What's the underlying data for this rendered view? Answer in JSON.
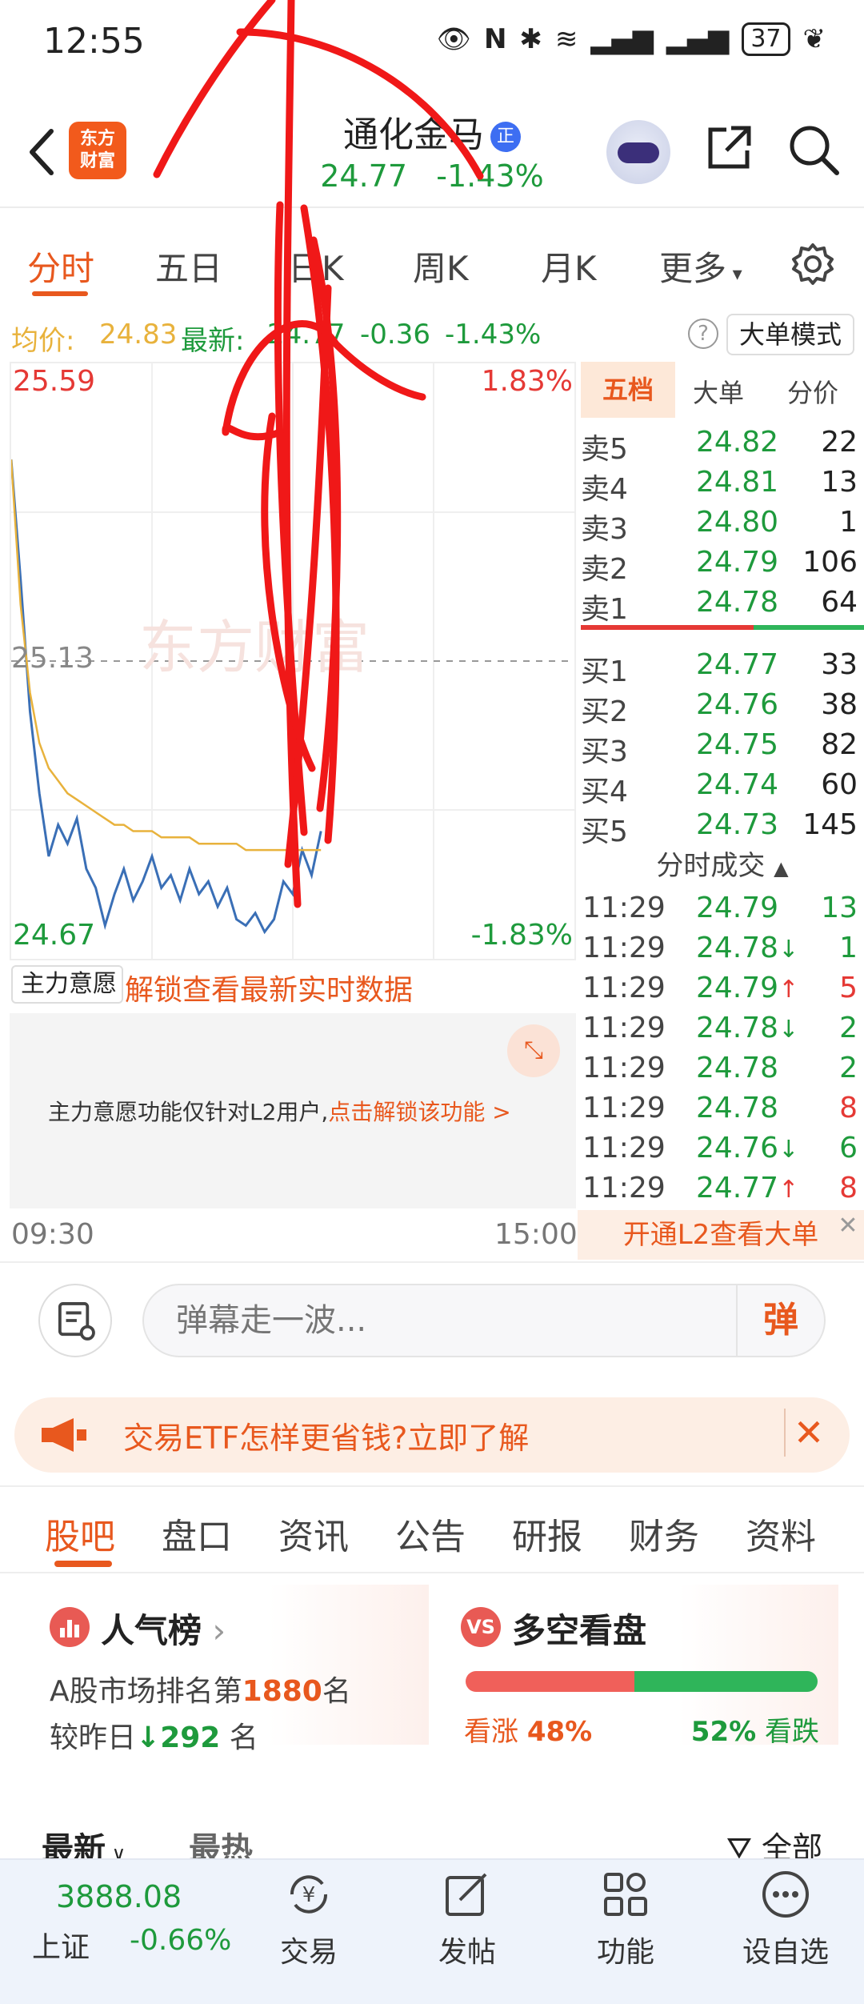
{
  "status_bar": {
    "time": "12:55",
    "battery": "37"
  },
  "header": {
    "app_logo": "东方\n财富",
    "stock_name": "通化金马",
    "badge": "正",
    "price": "24.77",
    "change_pct": "-1.43%"
  },
  "period_tabs": [
    "分时",
    "五日",
    "日K",
    "周K",
    "月K",
    "更多"
  ],
  "info_strip": {
    "avg_label": "均价:",
    "avg_value": "24.83",
    "latest_label": "最新:",
    "latest_value": "24.77",
    "change": "-0.36",
    "change_pct": "-1.43%",
    "mode_button": "大单模式"
  },
  "chart": {
    "high_label": "25.59",
    "high_pct": "1.83%",
    "mid_label": "25.13",
    "low_label": "24.67",
    "low_pct": "-1.83%",
    "time_start": "09:30",
    "time_end": "15:00",
    "watermark": "东方财富"
  },
  "chart_data": {
    "type": "line",
    "ylim": [
      24.67,
      25.59
    ],
    "reference": 25.13,
    "series": [
      {
        "name": "price",
        "color": "#3a6fb6",
        "values": [
          25.45,
          25.26,
          25.05,
          24.92,
          24.82,
          24.87,
          24.84,
          24.88,
          24.8,
          24.77,
          24.71,
          24.76,
          24.8,
          24.75,
          24.78,
          24.82,
          24.77,
          24.79,
          24.75,
          24.8,
          24.76,
          24.78,
          24.74,
          24.77,
          24.72,
          24.71,
          24.73,
          24.7,
          24.72,
          24.78,
          24.76,
          24.83,
          24.79,
          24.86
        ]
      },
      {
        "name": "avg",
        "color": "#e8b23c",
        "values": [
          25.45,
          25.22,
          25.08,
          25.0,
          24.96,
          24.94,
          24.92,
          24.91,
          24.9,
          24.89,
          24.88,
          24.87,
          24.87,
          24.86,
          24.86,
          24.86,
          24.85,
          24.85,
          24.85,
          24.85,
          24.84,
          24.84,
          24.84,
          24.84,
          24.84,
          24.83,
          24.83,
          24.83,
          24.83,
          24.83,
          24.83,
          24.83,
          24.83,
          24.83
        ]
      }
    ]
  },
  "order_book": {
    "tabs": [
      "五档",
      "大单",
      "分价"
    ],
    "sells": [
      {
        "label": "卖5",
        "price": "24.82",
        "vol": "22"
      },
      {
        "label": "卖4",
        "price": "24.81",
        "vol": "13"
      },
      {
        "label": "卖3",
        "price": "24.80",
        "vol": "1"
      },
      {
        "label": "卖2",
        "price": "24.79",
        "vol": "106"
      },
      {
        "label": "卖1",
        "price": "24.78",
        "vol": "64"
      }
    ],
    "buys": [
      {
        "label": "买1",
        "price": "24.77",
        "vol": "33"
      },
      {
        "label": "买2",
        "price": "24.76",
        "vol": "38"
      },
      {
        "label": "买3",
        "price": "24.75",
        "vol": "82"
      },
      {
        "label": "买4",
        "price": "24.74",
        "vol": "60"
      },
      {
        "label": "买5",
        "price": "24.73",
        "vol": "145"
      }
    ],
    "trades_header": "分时成交",
    "trades": [
      {
        "time": "11:29",
        "price": "24.79",
        "arrow": "",
        "vol": "13",
        "color": "#1e9a3c"
      },
      {
        "time": "11:29",
        "price": "24.78",
        "arrow": "↓",
        "vol": "1",
        "color": "#1e9a3c"
      },
      {
        "time": "11:29",
        "price": "24.79",
        "arrow": "↑",
        "vol": "5",
        "color": "#e53935"
      },
      {
        "time": "11:29",
        "price": "24.78",
        "arrow": "↓",
        "vol": "2",
        "color": "#1e9a3c"
      },
      {
        "time": "11:29",
        "price": "24.78",
        "arrow": "",
        "vol": "2",
        "color": "#1e9a3c"
      },
      {
        "time": "11:29",
        "price": "24.78",
        "arrow": "",
        "vol": "8",
        "color": "#e53935"
      },
      {
        "time": "11:29",
        "price": "24.76",
        "arrow": "↓",
        "vol": "6",
        "color": "#1e9a3c"
      },
      {
        "time": "11:29",
        "price": "24.77",
        "arrow": "↑",
        "vol": "8",
        "color": "#e53935"
      }
    ],
    "l2_open": "开通L2查看大单"
  },
  "main_force": {
    "selector": "主力意愿",
    "unlock": "解锁查看最新实时数据",
    "notice": "主力意愿功能仅针对L2用户,",
    "notice_link": "点击解锁该功能 >"
  },
  "danmu": {
    "placeholder": "弹幕走一波...",
    "button": "弹"
  },
  "ad": {
    "text": "交易ETF怎样更省钱?立即了解"
  },
  "content_tabs": [
    "股吧",
    "盘口",
    "资讯",
    "公告",
    "研报",
    "财务",
    "资料"
  ],
  "popularity": {
    "title": "人气榜",
    "line1_prefix": "A股市场排名第",
    "rank": "1880",
    "line1_suffix": "名",
    "line2_prefix": "较昨日",
    "delta": "292",
    "line2_suffix": "名"
  },
  "sentiment": {
    "title": "多空看盘",
    "up_label": "看涨",
    "up_pct": "48%",
    "down_pct": "52%",
    "down_label": "看跌",
    "up_value": 48
  },
  "sort": {
    "latest": "最新",
    "hot": "最热",
    "filter": "全部"
  },
  "bottom_nav": {
    "index_value": "3888.08",
    "index_name": "上证",
    "index_change": "-0.66%",
    "items": [
      "交易",
      "发帖",
      "功能",
      "设自选"
    ]
  },
  "colors": {
    "accent": "#e8581e",
    "up": "#e53935",
    "down": "#1e9a3c",
    "price_line": "#3a6fb6",
    "avg_line": "#e8b23c"
  }
}
